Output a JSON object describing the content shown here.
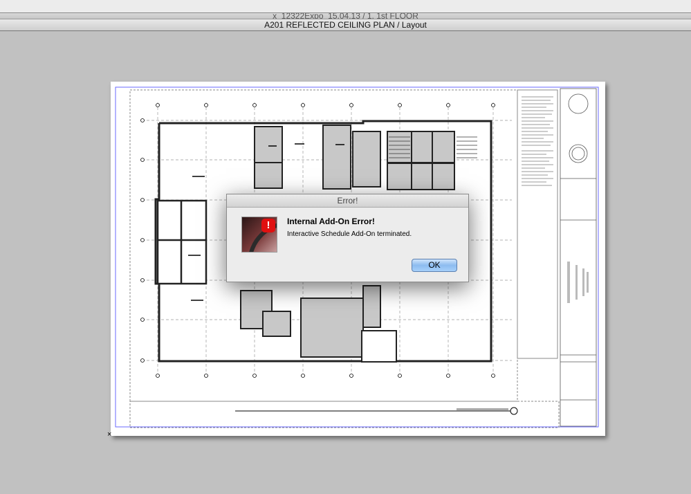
{
  "background_window": {
    "title": "x_12322Expo_15.04.13 / 1. 1st FLOOR"
  },
  "window": {
    "title": "A201 REFLECTED CEILING PLAN / Layout"
  },
  "layout": {
    "corner_marker": "×"
  },
  "dialog": {
    "title": "Error!",
    "icon": "error-stop-icon",
    "heading": "Internal Add-On Error!",
    "message": "Interactive Schedule Add-On terminated.",
    "ok_label": "OK",
    "accent_color": "#8dbcf0"
  }
}
